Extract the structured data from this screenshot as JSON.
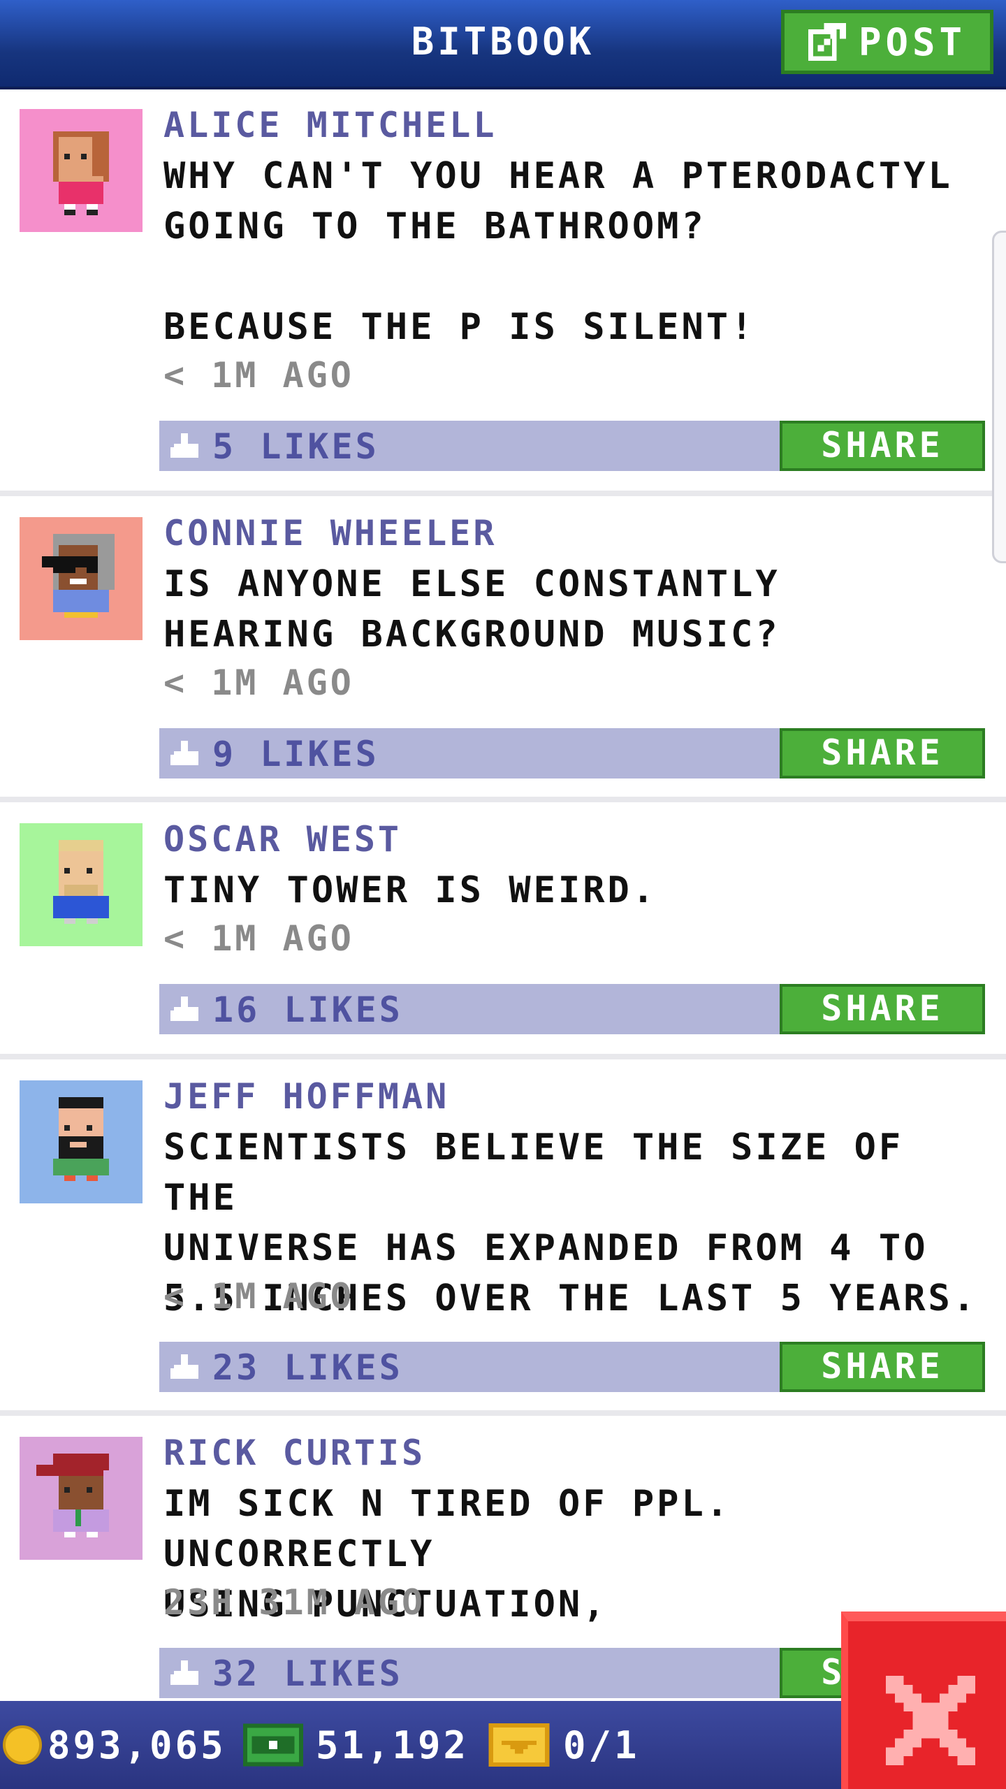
{
  "app": {
    "title": "BITBOOK",
    "post_label": "POST"
  },
  "posts": [
    {
      "author": "ALICE MITCHELL",
      "body": "WHY CAN'T YOU HEAR A PTERODACTYL\nGOING TO THE BATHROOM?\n\nBECAUSE THE P IS SILENT!",
      "time": "< 1M AGO",
      "likes": "5 LIKES",
      "share": "SHARE",
      "avatar_bg": "#f58fcb"
    },
    {
      "author": "CONNIE WHEELER",
      "body": "IS ANYONE ELSE CONSTANTLY\nHEARING BACKGROUND MUSIC?",
      "time": "< 1M AGO",
      "likes": "9 LIKES",
      "share": "SHARE",
      "avatar_bg": "#f49a8c"
    },
    {
      "author": "OSCAR WEST",
      "body": "TINY TOWER IS WEIRD.",
      "time": "< 1M AGO",
      "likes": "16 LIKES",
      "share": "SHARE",
      "avatar_bg": "#a7f59b"
    },
    {
      "author": "JEFF HOFFMAN",
      "body": "SCIENTISTS BELIEVE THE SIZE OF THE\nUNIVERSE HAS EXPANDED FROM 4 TO\n5.5 INCHES OVER THE LAST 5 YEARS.",
      "time": "< 1M AGO",
      "likes": "23 LIKES",
      "share": "SHARE",
      "avatar_bg": "#8db4ea"
    },
    {
      "author": "RICK CURTIS",
      "body": "IM SICK N TIRED OF PPL. UNCORRECTLY\nUSING PUNCTUATION,",
      "time": "23H 31M AGO",
      "likes": "32 LIKES",
      "share": "SHARE",
      "avatar_bg": "#d9a2d9"
    }
  ],
  "footer": {
    "coins": "893,065",
    "bux": "51,192",
    "tickets": "0/1"
  },
  "colors": {
    "header_blue": "#1a3a8a",
    "share_green": "#4caf3a",
    "like_bar": "#b2b5d9",
    "author_text": "#5a5aa0",
    "close_red": "#e8242a"
  }
}
